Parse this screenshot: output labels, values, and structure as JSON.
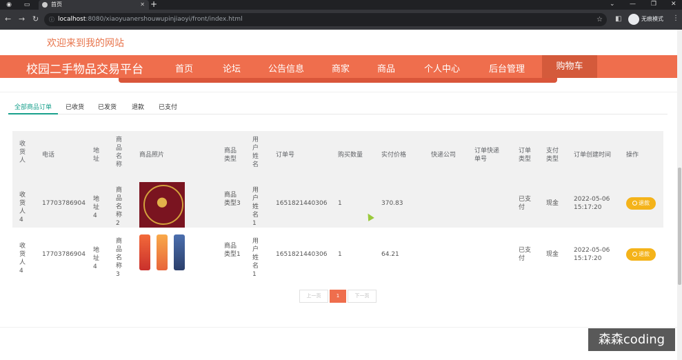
{
  "browser": {
    "tab_title": "首页",
    "url_host": "localhost",
    "url_path": ":8080/xiaoyuanershouwupinjiaoyi/front/index.html",
    "incognito_label": "无痕模式"
  },
  "header": {
    "welcome": "欢迎来到我的网站",
    "brand": "校园二手物品交易平台",
    "nav": [
      "首页",
      "论坛",
      "公告信息",
      "商家",
      "商品",
      "个人中心",
      "后台管理"
    ],
    "cart": "购物车"
  },
  "order_tabs": [
    "全部商品订单",
    "已收货",
    "已发货",
    "退款",
    "已支付"
  ],
  "table": {
    "headers": [
      "收货人",
      "电话",
      "地址",
      "商品名称",
      "商品照片",
      "商品类型",
      "用户姓名",
      "订单号",
      "购买数量",
      "实付价格",
      "快递公司",
      "订单快递单号",
      "订单类型",
      "支付类型",
      "订单创建时间",
      "操作"
    ],
    "rows": [
      {
        "receiver": "收货人4",
        "phone": "17703786904",
        "address": "地址4",
        "product": "商品名称2",
        "photo": "gold-jewelry-image",
        "type": "商品类型3",
        "user": "用户姓名1",
        "order_no": "1651821440306",
        "qty": "1",
        "price": "370.83",
        "courier": "",
        "tracking": "",
        "order_type": "已支付",
        "pay_type": "现金",
        "created": "2022-05-06 15:17:20",
        "action": "退款"
      },
      {
        "receiver": "收货人4",
        "phone": "17703786904",
        "address": "地址4",
        "product": "商品名称3",
        "photo": "phones-image",
        "type": "商品类型1",
        "user": "用户姓名1",
        "order_no": "1651821440306",
        "qty": "1",
        "price": "64.21",
        "courier": "",
        "tracking": "",
        "order_type": "已支付",
        "pay_type": "现金",
        "created": "2022-05-06 15:17:20",
        "action": "退款"
      }
    ]
  },
  "pager": {
    "prev": "上一页",
    "current": "1",
    "next": "下一页"
  },
  "watermark": "森森coding",
  "colors": {
    "brand": "#ef6e4d",
    "active_tab": "#18a08c",
    "refund": "#f4b31a"
  }
}
